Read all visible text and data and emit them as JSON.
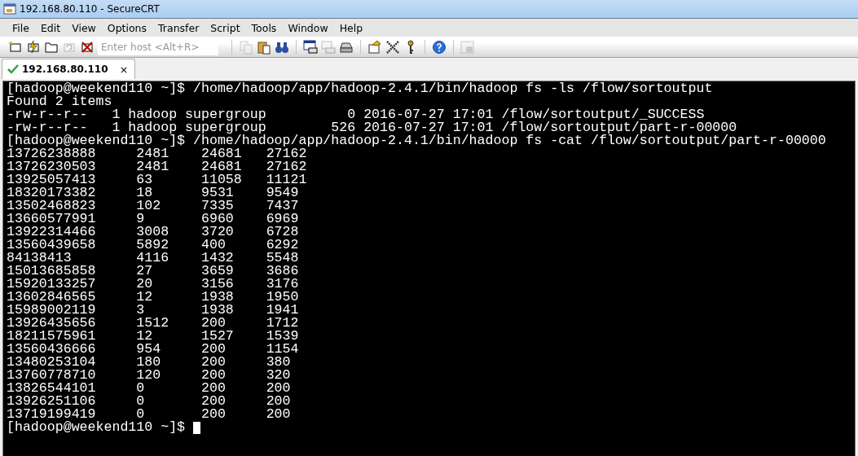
{
  "window": {
    "title": "192.168.80.110 - SecureCRT"
  },
  "menu": [
    "File",
    "Edit",
    "View",
    "Options",
    "Transfer",
    "Script",
    "Tools",
    "Window",
    "Help"
  ],
  "toolbar": {
    "host_field": {
      "placeholder": "Enter host <Alt+R>"
    }
  },
  "tabs": [
    {
      "label": "192.168.80.110",
      "selected": true,
      "connected": true,
      "close": "×"
    }
  ],
  "terminal": {
    "lines": [
      "[hadoop@weekend110 ~]$ /home/hadoop/app/hadoop-2.4.1/bin/hadoop fs -ls /flow/sortoutput",
      "Found 2 items",
      "-rw-r--r--   1 hadoop supergroup          0 2016-07-27 17:01 /flow/sortoutput/_SUCCESS",
      "-rw-r--r--   1 hadoop supergroup        526 2016-07-27 17:01 /flow/sortoutput/part-r-00000",
      "[hadoop@weekend110 ~]$ /home/hadoop/app/hadoop-2.4.1/bin/hadoop fs -cat /flow/sortoutput/part-r-00000",
      "13726238888     2481    24681   27162",
      "13726230503     2481    24681   27162",
      "13925057413     63      11058   11121",
      "18320173382     18      9531    9549",
      "13502468823     102     7335    7437",
      "13660577991     9       6960    6969",
      "13922314466     3008    3720    6728",
      "13560439658     5892    400     6292",
      "84138413        4116    1432    5548",
      "15013685858     27      3659    3686",
      "15920133257     20      3156    3176",
      "13602846565     12      1938    1950",
      "15989002119     3       1938    1941",
      "13926435656     1512    200     1712",
      "18211575961     12      1527    1539",
      "13560436666     954     200     1154",
      "13480253104     180     200     380",
      "13760778710     120     200     320",
      "13826544101     0       200     200",
      "13926251106     0       200     200",
      "13719199419     0       200     200",
      "[hadoop@weekend110 ~]$ "
    ],
    "cursor": true
  }
}
